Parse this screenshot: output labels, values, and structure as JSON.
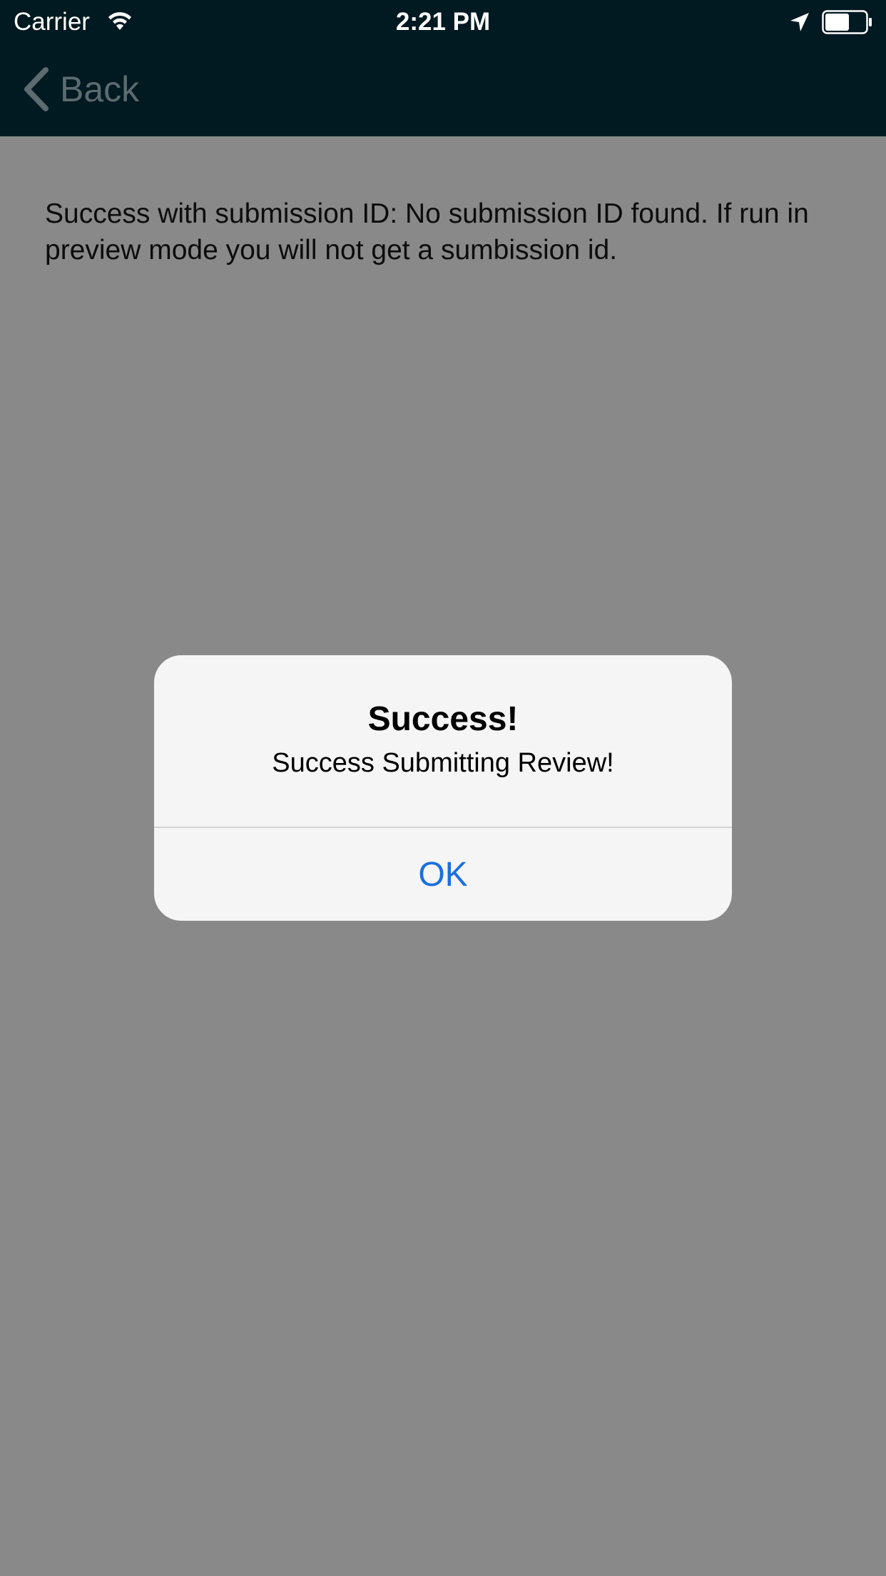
{
  "status_bar": {
    "carrier": "Carrier",
    "time": "2:21 PM",
    "battery_level_percent": 60
  },
  "nav_bar": {
    "back_label": "Back"
  },
  "content": {
    "message": "Success with submission ID: No submission ID found. If run in preview mode you will not get a sumbission id."
  },
  "alert": {
    "title": "Success!",
    "message": "Success Submitting Review!",
    "ok_label": "OK"
  },
  "colors": {
    "header_background": "#011920",
    "screen_background": "#898989",
    "alert_background": "#f5f5f5",
    "alert_button": "#1a6ee0"
  },
  "icons": {
    "wifi": "wifi-icon",
    "location": "location-arrow-icon",
    "battery": "battery-icon",
    "back": "chevron-left-icon"
  }
}
